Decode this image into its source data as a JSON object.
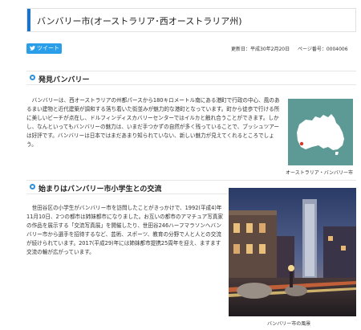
{
  "page": {
    "title": "バンバリー市(オーストラリア･西オーストラリア州)"
  },
  "share": {
    "tweet_label": "ツイート"
  },
  "meta": {
    "updated": "更新日：平成30年2月20日",
    "page_no": "ページ番号：0004006"
  },
  "section1": {
    "heading": "発見バンバリー",
    "body": "バンバリーは、西オーストラリアの州都パースから180キロメートル南にある港町で行政の中心、風のあるまい建物と近代建築が調和する落ち着いた街並みが魅力的な港町となっています。町から徒歩で行ける所に美しいビーチが点在し、ドルフィンディスカバリーセンターではイルカと触れ合うことができます。しかし、なんといってもバンバリーの魅力は、いまだ手つかずの自然が多く残っていることで、ブッシュツアーは好評です。バンバリーは日本ではまだあまり知られていない、新しい魅力が見えてくれるところでしょう。",
    "map_caption": "オーストラリア・バンバリー市"
  },
  "section2": {
    "heading": "始まりはバンバリー市小学生との交流",
    "body": "世田谷区の小学生がバンバリー市を訪問したことがきっかけで、1992(平成4)年11月10日、2つの都市は姉妹都市になりました。お互いの都市のアマチュア写真家の作品を展示する「交流写真展」を開催したり、世田谷246ハーフマラソンへバンバリー市から選手を招待するなど、芸術、スポーツ、教育の分野で人と人との交流が続けられています。2017(平成29)年には姉妹都市提携25周年を迎え、ますます交流の輪が広がっています。",
    "photo_caption": "バンバリー市の風景"
  },
  "colors": {
    "accent": "#1a73c8",
    "tweet": "#2a9ee9",
    "section_icon": "#2b8ed9",
    "map_bg": "#5d9a95"
  }
}
